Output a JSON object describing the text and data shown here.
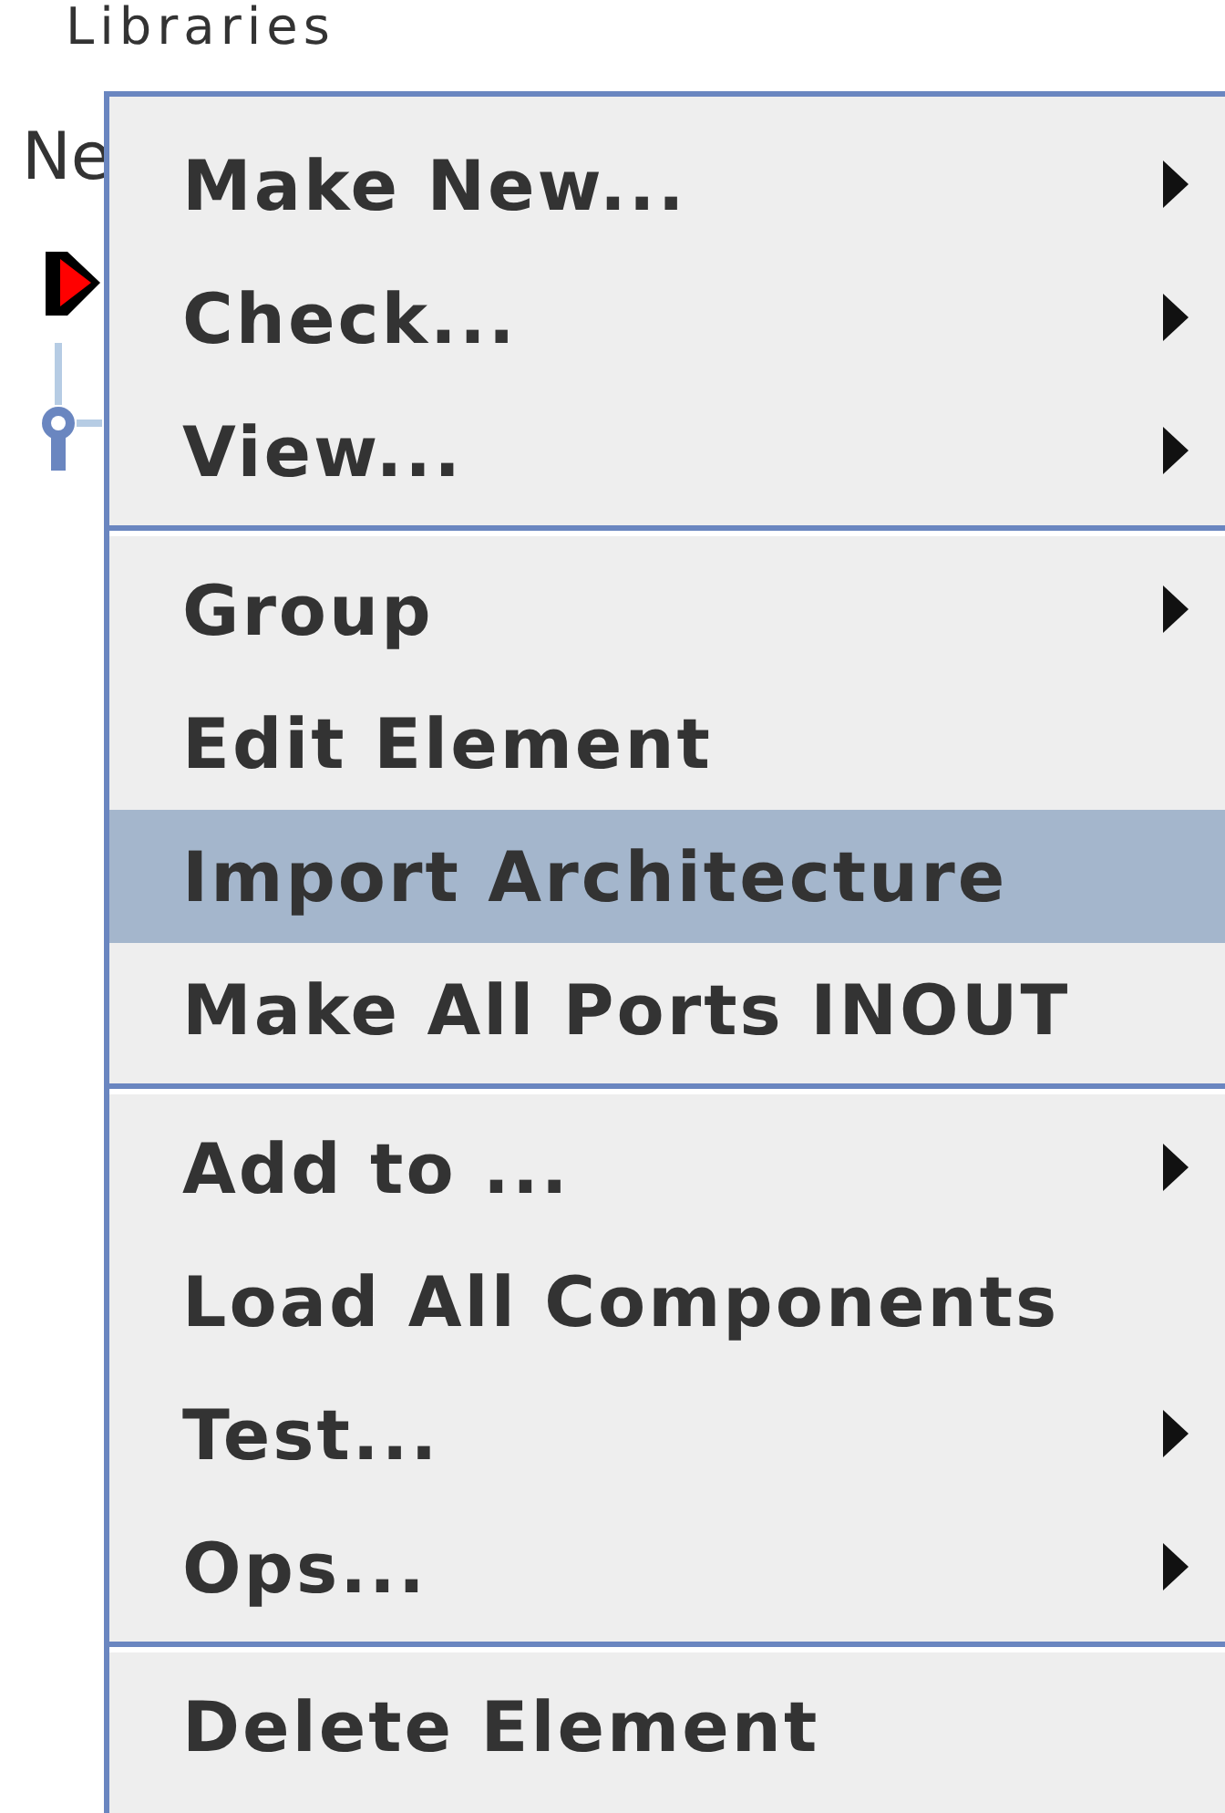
{
  "header": "Libraries",
  "tree_label": "Ne",
  "menu": {
    "sections": [
      {
        "items": [
          {
            "label": "Make New...",
            "submenu": true,
            "selected": false
          },
          {
            "label": "Check...",
            "submenu": true,
            "selected": false
          },
          {
            "label": "View...",
            "submenu": true,
            "selected": false
          }
        ]
      },
      {
        "items": [
          {
            "label": "Group",
            "submenu": true,
            "selected": false
          },
          {
            "label": "Edit Element",
            "submenu": false,
            "selected": false
          },
          {
            "label": "Import Architecture",
            "submenu": false,
            "selected": true
          },
          {
            "label": "Make All Ports INOUT",
            "submenu": false,
            "selected": false
          }
        ]
      },
      {
        "items": [
          {
            "label": "Add to ...",
            "submenu": true,
            "selected": false
          },
          {
            "label": "Load All Components",
            "submenu": false,
            "selected": false
          },
          {
            "label": "Test...",
            "submenu": true,
            "selected": false
          },
          {
            "label": "Ops...",
            "submenu": true,
            "selected": false
          }
        ]
      },
      {
        "items": [
          {
            "label": "Delete Element",
            "submenu": false,
            "selected": false
          }
        ]
      }
    ]
  }
}
